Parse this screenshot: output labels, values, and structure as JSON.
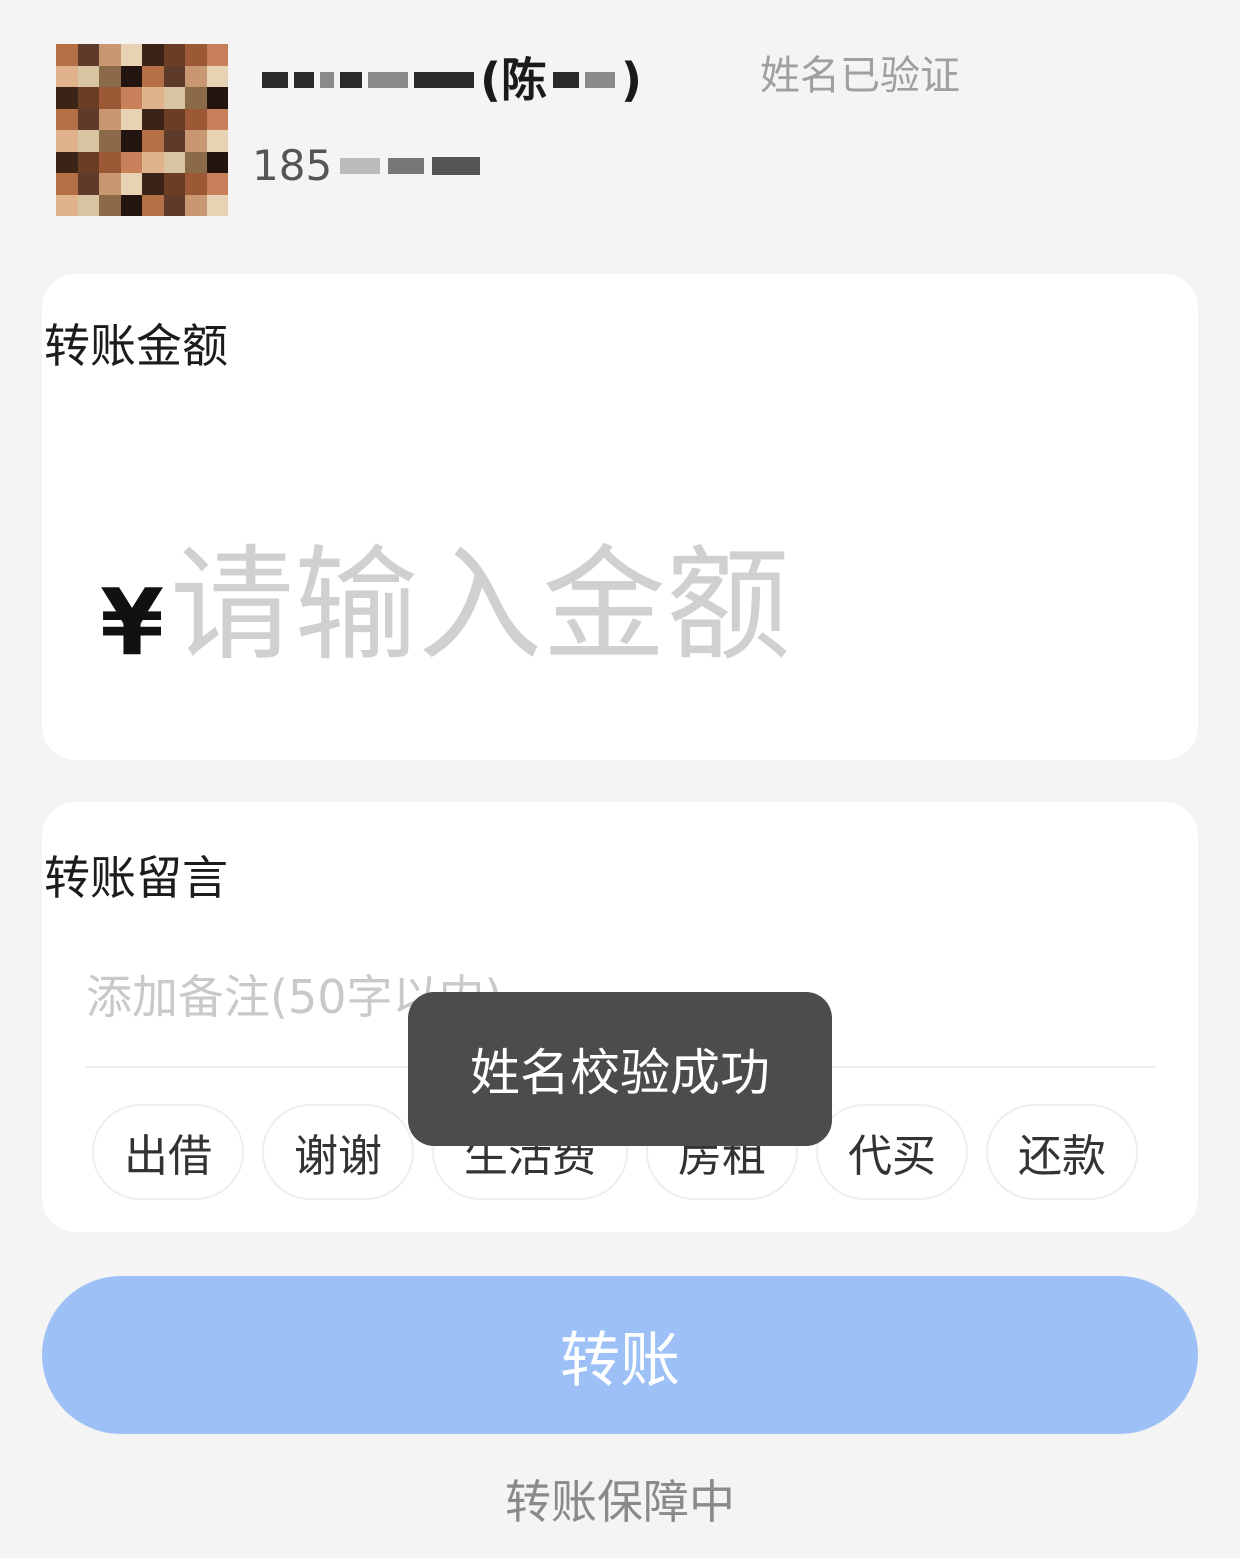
{
  "header": {
    "name_char": "(陈",
    "name_close": ")",
    "verified_label": "姓名已验证",
    "phone_prefix": "185"
  },
  "amount_card": {
    "title": "转账金额",
    "currency_symbol": "¥",
    "placeholder": "请输入金额"
  },
  "note_card": {
    "title": "转账留言",
    "placeholder": "添加备注(50字以内)",
    "chips": [
      "出借",
      "谢谢",
      "生活费",
      "房租",
      "代买",
      "还款"
    ]
  },
  "toast": {
    "text": "姓名校验成功"
  },
  "submit_label": "转账",
  "footer_text": "转账保障中",
  "colors": {
    "submit_bg": "#9dc1f7",
    "toast_bg": "#4c4c4c",
    "page_bg": "#f4f4f4"
  }
}
